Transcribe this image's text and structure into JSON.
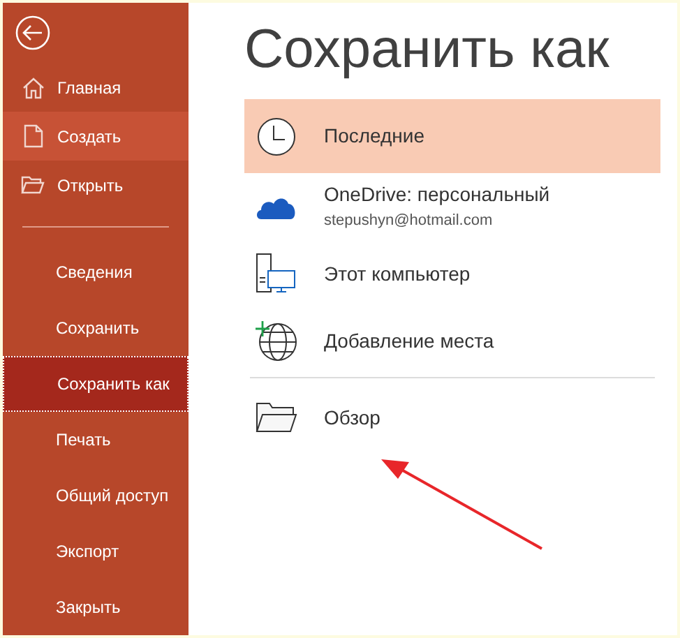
{
  "sidebar": {
    "top_items": [
      {
        "label": "Главная",
        "kind": "home",
        "selected": false,
        "hovered": false
      },
      {
        "label": "Создать",
        "kind": "new",
        "selected": false,
        "hovered": true
      },
      {
        "label": "Открыть",
        "kind": "open",
        "selected": false,
        "hovered": false
      }
    ],
    "items": [
      {
        "label": "Сведения",
        "selected": false
      },
      {
        "label": "Сохранить",
        "selected": false
      },
      {
        "label": "Сохранить как",
        "selected": true
      },
      {
        "label": "Печать",
        "selected": false
      },
      {
        "label": "Общий доступ",
        "selected": false
      },
      {
        "label": "Экспорт",
        "selected": false
      },
      {
        "label": "Закрыть",
        "selected": false
      }
    ]
  },
  "title": "Сохранить как",
  "locations": [
    {
      "label": "Последние",
      "kind": "recent",
      "selected": true
    },
    {
      "label": "OneDrive: персональный",
      "subtitle": "stepushyn@hotmail.com",
      "kind": "cloud",
      "selected": false
    },
    {
      "label": "Этот компьютер",
      "kind": "computer",
      "selected": false
    },
    {
      "label": "Добавление места",
      "kind": "add",
      "selected": false
    }
  ],
  "browse": {
    "label": "Обзор"
  }
}
